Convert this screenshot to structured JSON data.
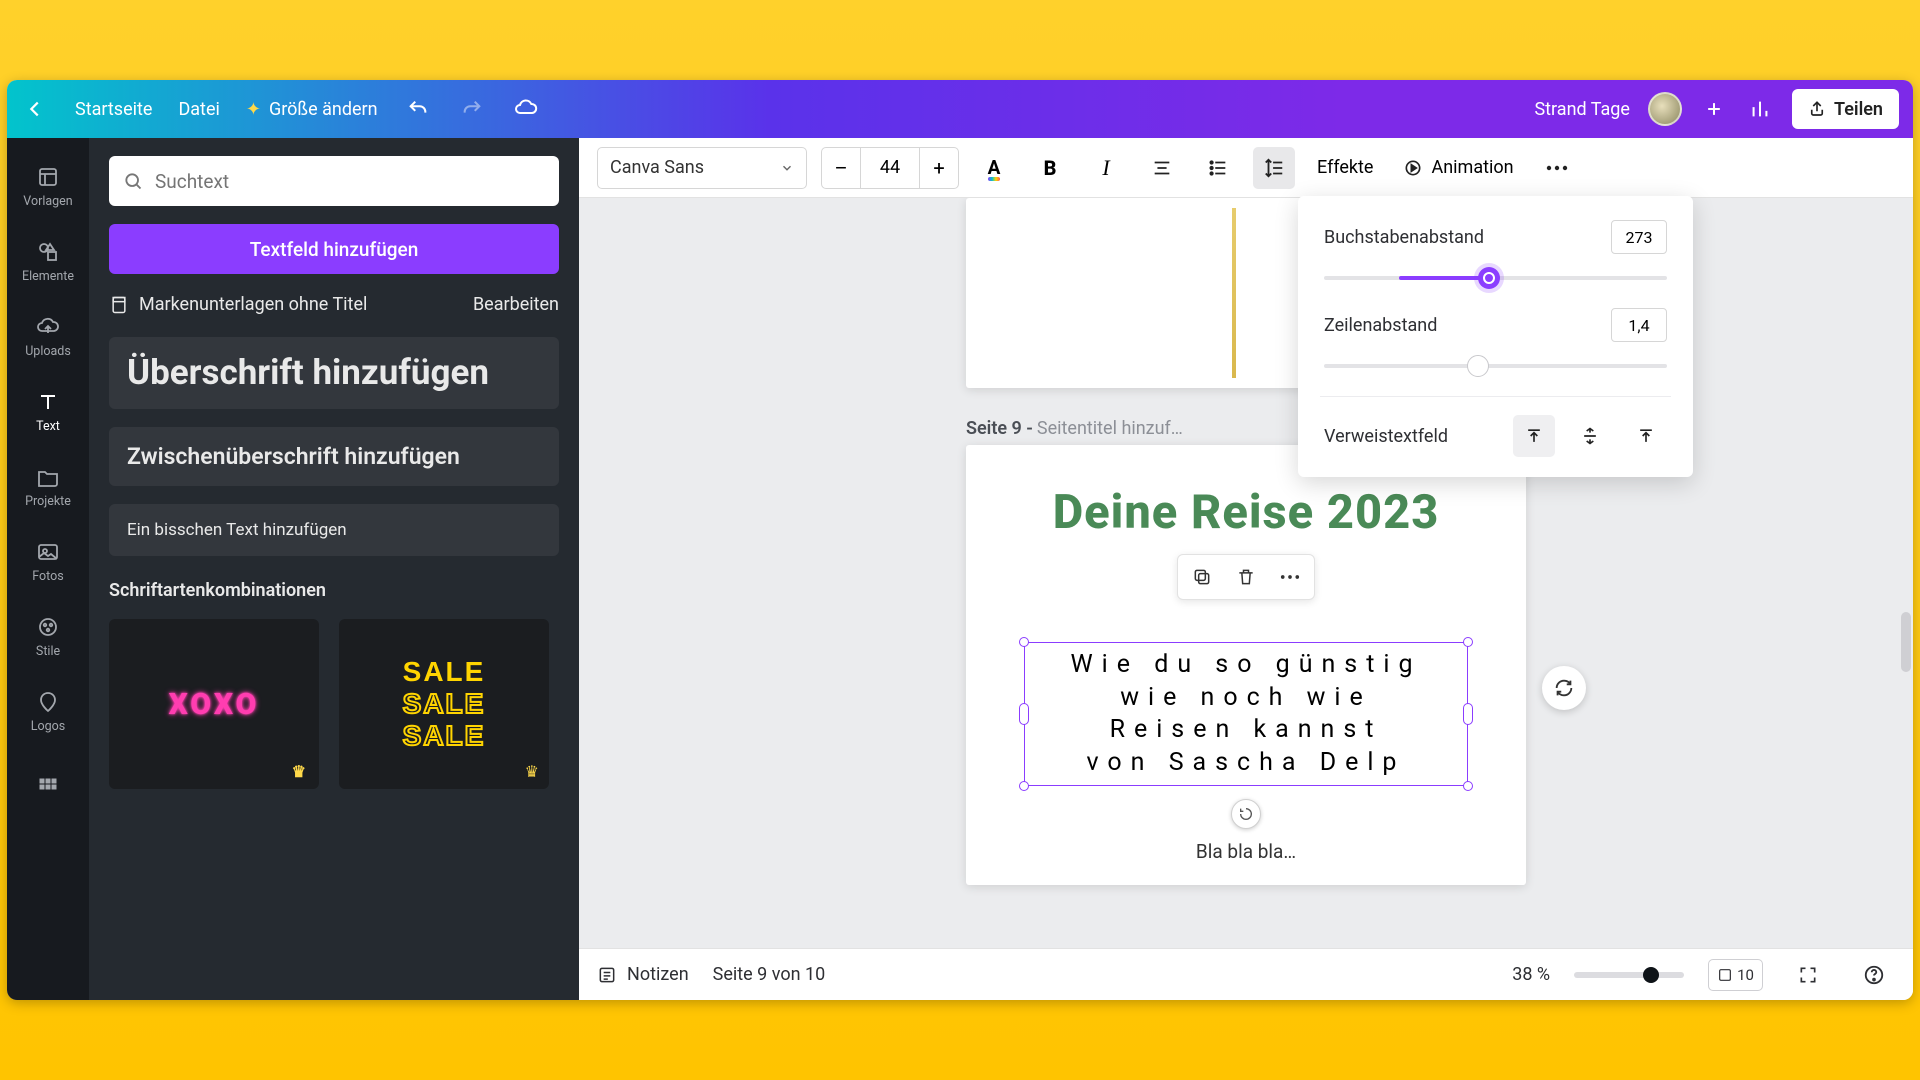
{
  "topbar": {
    "home": "Startseite",
    "file": "Datei",
    "resize": "Größe ändern",
    "doc_title": "Strand Tage",
    "share": "Teilen"
  },
  "vnav": {
    "templates": "Vorlagen",
    "elements": "Elemente",
    "uploads": "Uploads",
    "text": "Text",
    "projects": "Projekte",
    "photos": "Fotos",
    "styles": "Stile",
    "logos": "Logos"
  },
  "panel": {
    "search_placeholder": "Suchtext",
    "add_textbox": "Textfeld hinzufügen",
    "brand_docs": "Markenunterlagen ohne Titel",
    "edit": "Bearbeiten",
    "heading": "Überschrift hinzufügen",
    "subheading": "Zwischenüberschrift hinzufügen",
    "body_text": "Ein bisschen Text hinzufügen",
    "combos_title": "Schriftartenkombinationen",
    "combo1": "XOXO",
    "combo2": "SALE"
  },
  "toolbar": {
    "font": "Canva Sans",
    "size": "44",
    "effects": "Effekte",
    "animation": "Animation"
  },
  "popover": {
    "letter_spacing_label": "Buchstabenabstand",
    "letter_spacing_value": "273",
    "line_height_label": "Zeilenabstand",
    "line_height_value": "1,4",
    "anchor_label": "Verweistextfeld"
  },
  "canvas": {
    "page_label_prefix": "Seite 9 - ",
    "page_title_placeholder": "Seitentitel hinzuf…",
    "doc_title": "Deine Reise 2023",
    "text_line1": "Wie du so günstig",
    "text_line2": "wie noch wie",
    "text_line3": "Reisen kannst",
    "text_line4": "von Sascha Delp",
    "below_text": "Bla bla bla…"
  },
  "status": {
    "notes": "Notizen",
    "page_of": "Seite 9 von 10",
    "zoom": "38 %",
    "page_total": "10"
  }
}
